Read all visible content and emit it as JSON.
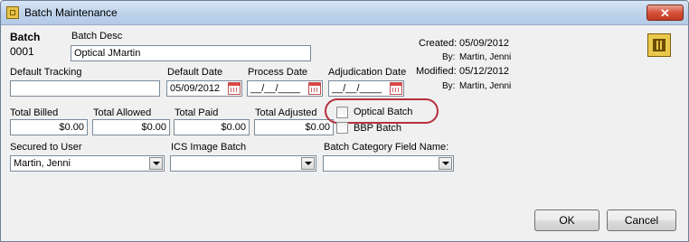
{
  "window": {
    "title": "Batch Maintenance",
    "close_glyph": "✕"
  },
  "batch": {
    "label": "Batch",
    "number": "0001"
  },
  "batch_desc": {
    "label": "Batch Desc",
    "value": "Optical JMartin"
  },
  "audit": {
    "created_label": "Created:",
    "created_date": "05/09/2012",
    "created_by_label": "By:",
    "created_by": "Martin, Jenni",
    "modified_label": "Modified:",
    "modified_date": "05/12/2012",
    "modified_by_label": "By:",
    "modified_by": "Martin, Jenni"
  },
  "tracking": {
    "label": "Default Tracking",
    "value": ""
  },
  "dates": {
    "default_label": "Default Date",
    "default_value": "05/09/2012",
    "process_label": "Process Date",
    "process_value": "__/__/____",
    "adjudication_label": "Adjudication Date",
    "adjudication_value": "__/__/____"
  },
  "totals": {
    "billed_label": "Total Billed",
    "billed": "$0.00",
    "allowed_label": "Total Allowed",
    "allowed": "$0.00",
    "paid_label": "Total Paid",
    "paid": "$0.00",
    "adjusted_label": "Total Adjusted",
    "adjusted": "$0.00"
  },
  "checkboxes": {
    "optical_label": "Optical Batch",
    "optical_checked": false,
    "bbp_label": "BBP Batch",
    "bbp_checked": false
  },
  "secured_user": {
    "label": "Secured to User",
    "value": "Martin, Jenni"
  },
  "ics_image": {
    "label": "ICS Image Batch",
    "value": ""
  },
  "category": {
    "label": "Batch Category Field Name:",
    "value": ""
  },
  "buttons": {
    "ok": "OK",
    "cancel": "Cancel"
  },
  "colors": {
    "highlight_ring": "#b5303c",
    "titlebar": "#c4d7ee"
  }
}
